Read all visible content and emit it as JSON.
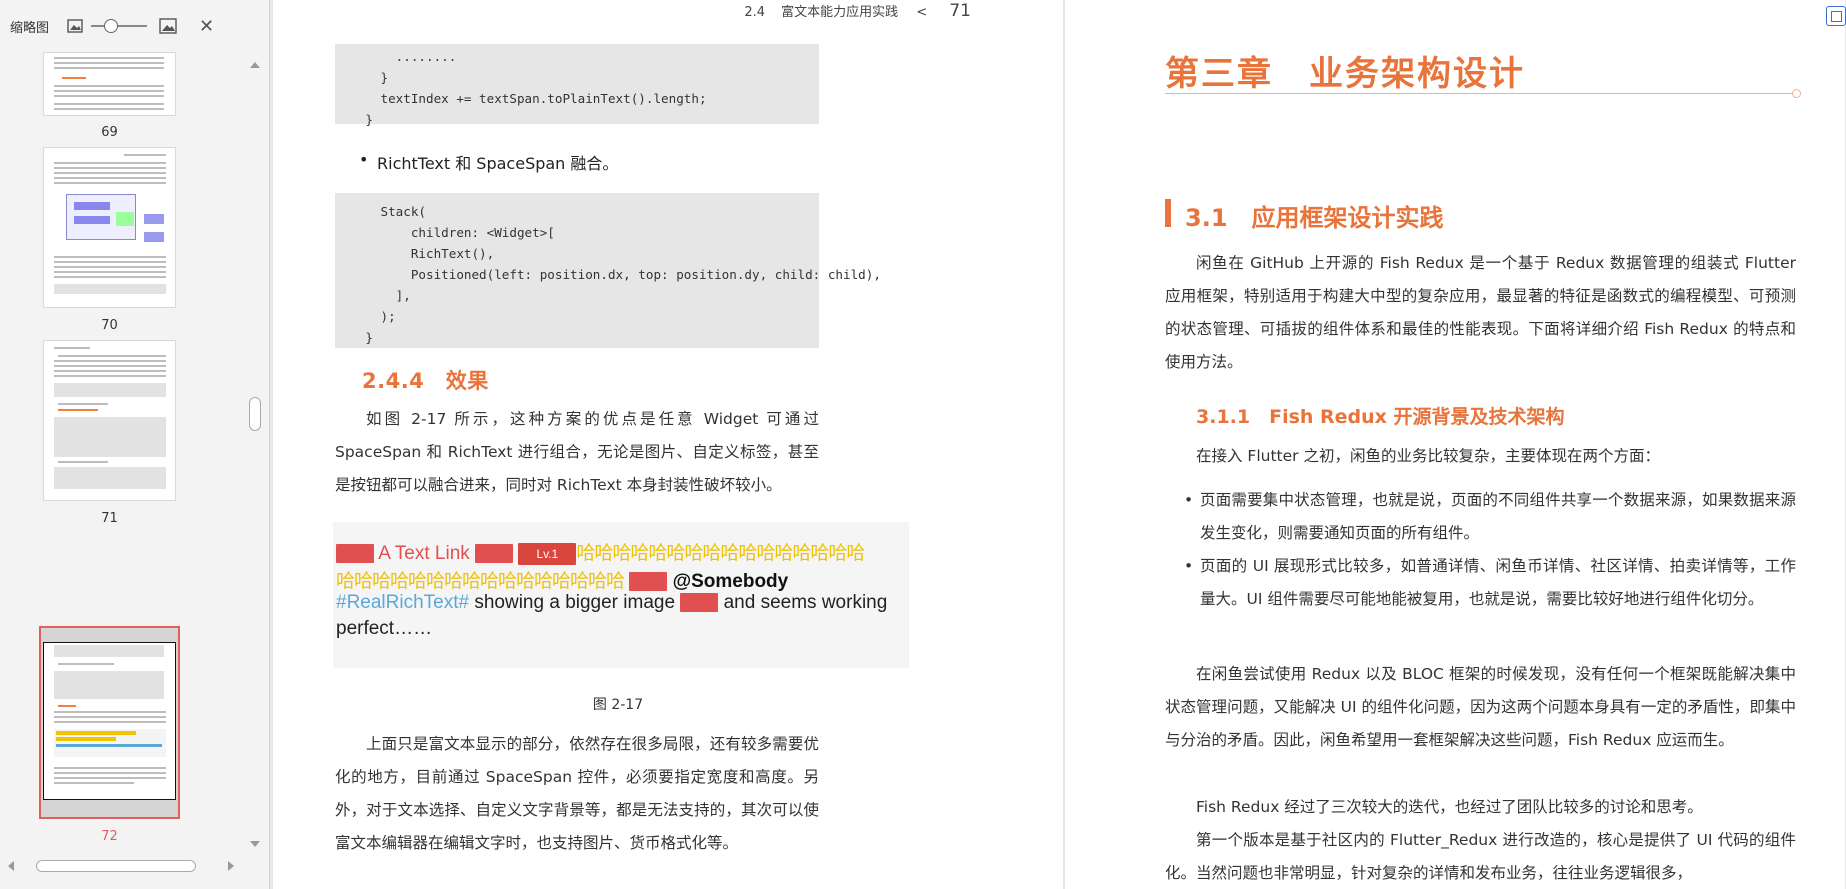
{
  "sidebar": {
    "title": "缩略图",
    "icons": [
      "image-small-icon",
      "image-large-icon",
      "close-icon"
    ],
    "zoom_level": 0.3,
    "close_label": "✕",
    "thumbnails": [
      {
        "page": "69"
      },
      {
        "page": "70"
      },
      {
        "page": "71"
      },
      {
        "page": "72",
        "current": true
      }
    ]
  },
  "left_page": {
    "running_head": {
      "section": "2.4",
      "title": "富文本能力应用实践",
      "separator": "<",
      "page": "71"
    },
    "code1": "        ........\n      }\n      textIndex += textSpan.toPlainText().length;\n    }",
    "bullet": "RichtText 和 SpaceSpan 融合。",
    "code2": "      Stack(\n          children: <Widget>[\n          RichText(),\n          Positioned(left: position.dx, top: position.dy, child: child),\n        ],\n      );\n    }",
    "section_title": "2.4.4　效果",
    "para1": "如图 2-17 所示，这种方案的优点是任意 Widget 可通过 SpaceSpan 和 RichText 进行组合，无论是图片、自定义标签，甚至是按钮都可以融合进来，同时对 RichText 本身封装性破坏较小。",
    "figure": {
      "line1_text": "A Text Link",
      "lv_badge": "Lv.1",
      "haha_line1": "哈哈哈哈哈哈哈哈哈哈哈哈哈哈哈哈",
      "haha_line2": "哈哈哈哈哈哈哈哈哈哈哈哈哈哈哈哈",
      "mention": "@Somebody",
      "hashtag": "#RealRichText#",
      "line3_mid": "showing a bigger image",
      "line3_end": "and seems working",
      "line4": "perfect……"
    },
    "figure_caption": "图 2-17",
    "para2": "上面只是富文本显示的部分，依然存在很多局限，还有较多需要优化的地方，目前通过 SpaceSpan 控件，必须要指定宽度和高度。另外，对于文本选择、自定义文字背景等，都是无法支持的，其次可以使富文本编辑器在编辑文字时，也支持图片、货币格式化等。"
  },
  "right_page": {
    "chapter_title": "第三章　业务架构设计",
    "h1": "3.1　应用框架设计实践",
    "p1": "闲鱼在 GitHub 上开源的 Fish Redux 是一个基于 Redux 数据管理的组装式 Flutter 应用框架，特别适用于构建大中型的复杂应用，最显著的特征是函数式的编程模型、可预测的状态管理、可插拔的组件体系和最佳的性能表现。下面将详细介绍 Fish Redux 的特点和使用方法。",
    "h2": "3.1.1　Fish Redux 开源背景及技术架构",
    "p2": "在接入 Flutter 之初，闲鱼的业务比较复杂，主要体现在两个方面：",
    "bullets": [
      "页面需要集中状态管理，也就是说，页面的不同组件共享一个数据来源，如果数据来源发生变化，则需要通知页面的所有组件。",
      "页面的 UI 展现形式比较多，如普通详情、闲鱼币详情、社区详情、拍卖详情等，工作量大。UI 组件需要尽可能地能被复用，也就是说，需要比较好地进行组件化切分。"
    ],
    "p3": "在闲鱼尝试使用 Redux 以及 BLOC 框架的时候发现，没有任何一个框架既能解决集中状态管理问题，又能解决 UI 的组件化问题，因为这两个问题本身具有一定的矛盾性，即集中与分治的矛盾。因此，闲鱼希望用一套框架解决这些问题，Fish Redux 应运而生。",
    "p4": "Fish Redux 经过了三次较大的迭代，也经过了团队比较多的讨论和思考。",
    "p5": "第一个版本是基于社区内的 Flutter_Redux 进行改造的，核心是提供了 UI 代码的组件化。当然问题也非常明显，针对复杂的详情和发布业务，往往业务逻辑很多，"
  },
  "colors": {
    "accent": "#e8743b",
    "selection": "#e35d5d",
    "hashtag": "#5aa8d8",
    "haha": "#f2c300"
  }
}
